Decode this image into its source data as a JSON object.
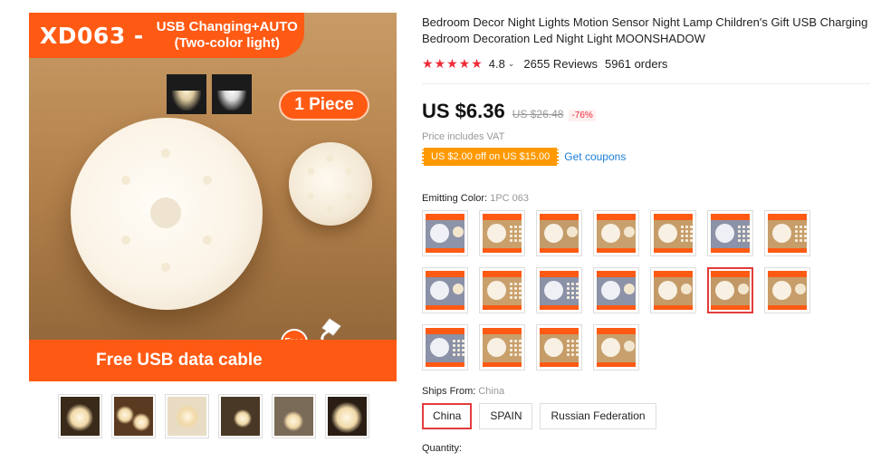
{
  "gallery": {
    "banner_code": "XD063 -",
    "banner_line1": "USB Changing+AUTO",
    "banner_line2": "(Two-color light)",
    "piece_badge": "1 Piece",
    "bottom_banner": "Free USB data cable",
    "free_badge": "Free",
    "thumbnails": 6
  },
  "product": {
    "title": "Bedroom Decor Night Lights Motion Sensor Night Lamp Children's Gift USB Charging Bedroom Decoration Led Night Light MOONSHADOW",
    "stars": "★★★★★",
    "rating": "4.8",
    "reviews": "2655 Reviews",
    "orders": "5961 orders"
  },
  "pricing": {
    "price": "US $6.36",
    "original_price": "US $26.48",
    "discount": "-76%",
    "vat_note": "Price includes VAT",
    "coupon": "US $2.00 off on US $15.00",
    "get_coupons": "Get coupons"
  },
  "color": {
    "label": "Emitting Color:",
    "selected": "1PC 063",
    "swatch_count": 17,
    "selected_index": 11
  },
  "shipping": {
    "label": "Ships From:",
    "selected": "China",
    "options": [
      "China",
      "SPAIN",
      "Russian Federation"
    ]
  },
  "quantity": {
    "label": "Quantity:"
  },
  "colors": {
    "accent": "#ff5a14",
    "sale_red": "#f02a38",
    "coupon_orange": "#ff9900",
    "link_blue": "#1a7fd6"
  }
}
